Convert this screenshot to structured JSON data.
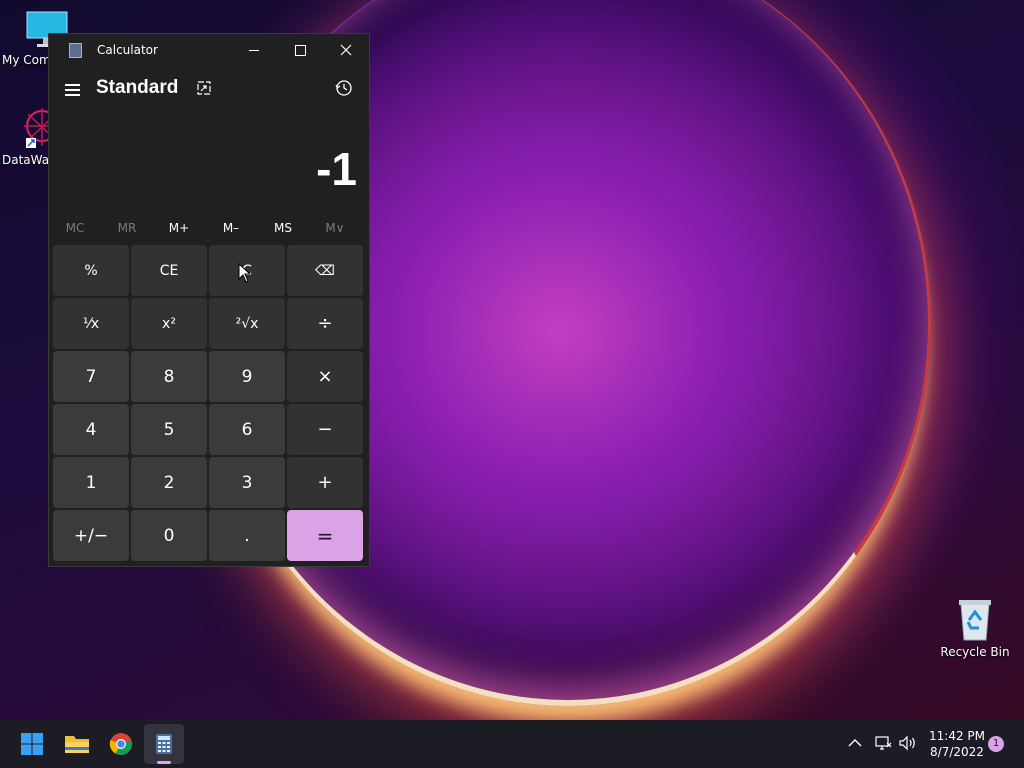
{
  "desktop": {
    "icons": [
      {
        "label": "My Com",
        "icon": "monitor-icon"
      },
      {
        "label": "DataWag",
        "icon": "datawagon-icon"
      },
      {
        "label": "Recycle Bin",
        "icon": "recycle-bin-icon"
      }
    ]
  },
  "calculator": {
    "window_title": "Calculator",
    "mode_title": "Standard",
    "display_value": "-1",
    "memory": [
      "MC",
      "MR",
      "M+",
      "M–",
      "MS",
      "M∨"
    ],
    "keys": [
      {
        "label": "%",
        "kind": "fn",
        "name": "percent-button"
      },
      {
        "label": "CE",
        "kind": "fn",
        "name": "clear-entry-button"
      },
      {
        "label": "C",
        "kind": "fn",
        "name": "clear-button"
      },
      {
        "label": "⌫",
        "kind": "fn",
        "name": "backspace-button"
      },
      {
        "label": "⅟x",
        "kind": "fn",
        "name": "reciprocal-button"
      },
      {
        "label": "x²",
        "kind": "fn",
        "name": "square-button"
      },
      {
        "label": "²√x",
        "kind": "fn",
        "name": "square-root-button"
      },
      {
        "label": "÷",
        "kind": "op",
        "name": "divide-button"
      },
      {
        "label": "7",
        "kind": "num",
        "name": "digit-7-button"
      },
      {
        "label": "8",
        "kind": "num",
        "name": "digit-8-button"
      },
      {
        "label": "9",
        "kind": "num",
        "name": "digit-9-button"
      },
      {
        "label": "×",
        "kind": "op",
        "name": "multiply-button"
      },
      {
        "label": "4",
        "kind": "num",
        "name": "digit-4-button"
      },
      {
        "label": "5",
        "kind": "num",
        "name": "digit-5-button"
      },
      {
        "label": "6",
        "kind": "num",
        "name": "digit-6-button"
      },
      {
        "label": "−",
        "kind": "op",
        "name": "subtract-button"
      },
      {
        "label": "1",
        "kind": "num",
        "name": "digit-1-button"
      },
      {
        "label": "2",
        "kind": "num",
        "name": "digit-2-button"
      },
      {
        "label": "3",
        "kind": "num",
        "name": "digit-3-button"
      },
      {
        "label": "+",
        "kind": "op",
        "name": "add-button"
      },
      {
        "label": "+/−",
        "kind": "num",
        "name": "negate-button"
      },
      {
        "label": "0",
        "kind": "num",
        "name": "digit-0-button"
      },
      {
        "label": ".",
        "kind": "num",
        "name": "decimal-button"
      },
      {
        "label": "=",
        "kind": "eq",
        "name": "equals-button"
      }
    ]
  },
  "taskbar": {
    "apps": [
      "start-icon",
      "file-explorer-icon",
      "chrome-icon",
      "calculator-icon"
    ],
    "clock_time": "11:42 PM",
    "clock_date": "8/7/2022",
    "notification_count": "1"
  },
  "colors": {
    "accent": "#dca2e6",
    "window_bg": "#202020",
    "key_num": "#3b3b3b",
    "key_fn": "#323232"
  }
}
